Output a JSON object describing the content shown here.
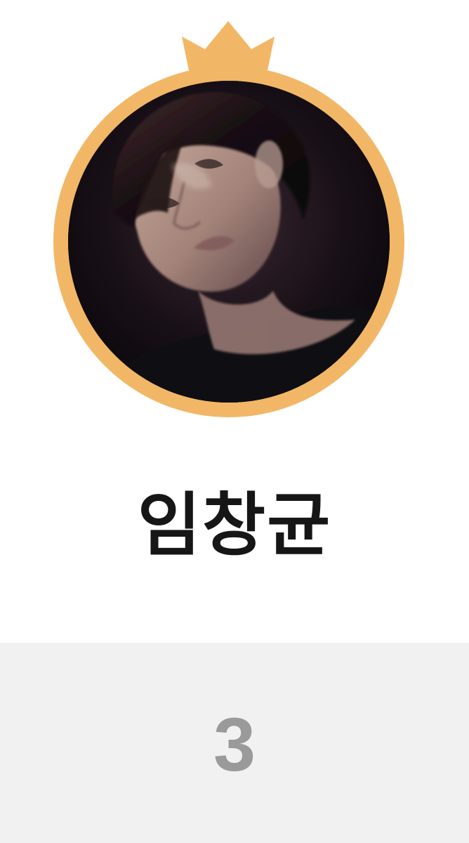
{
  "profile": {
    "name": "임창균",
    "rank": "3",
    "avatar_icon": "crown-icon",
    "frame_color": "#F2B766",
    "avatar_background": "#17111a"
  },
  "colors": {
    "name_text": "#161616",
    "rank_text": "#9a9a9a",
    "rank_bar_background": "#f1f1f2"
  }
}
